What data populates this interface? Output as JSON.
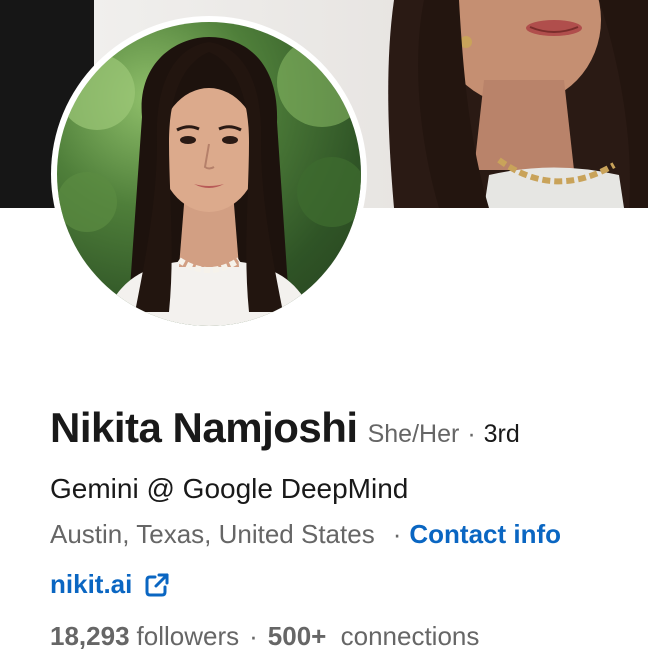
{
  "profile": {
    "name": "Nikita Namjoshi",
    "pronouns": "She/Her",
    "degree_separator": "·",
    "degree": "3rd",
    "headline": "Gemini @ Google DeepMind",
    "location": "Austin, Texas, United States",
    "location_separator": "·",
    "contact_info_label": "Contact info",
    "website": "nikit.ai",
    "website_icon": "external-link-icon",
    "followers_count": "18,293",
    "followers_label": "followers",
    "stats_separator": "·",
    "connections_count": "500+",
    "connections_label": "connections"
  },
  "colors": {
    "link": "#0a66c2",
    "primary_text": "#191919",
    "secondary_text": "#666666"
  }
}
